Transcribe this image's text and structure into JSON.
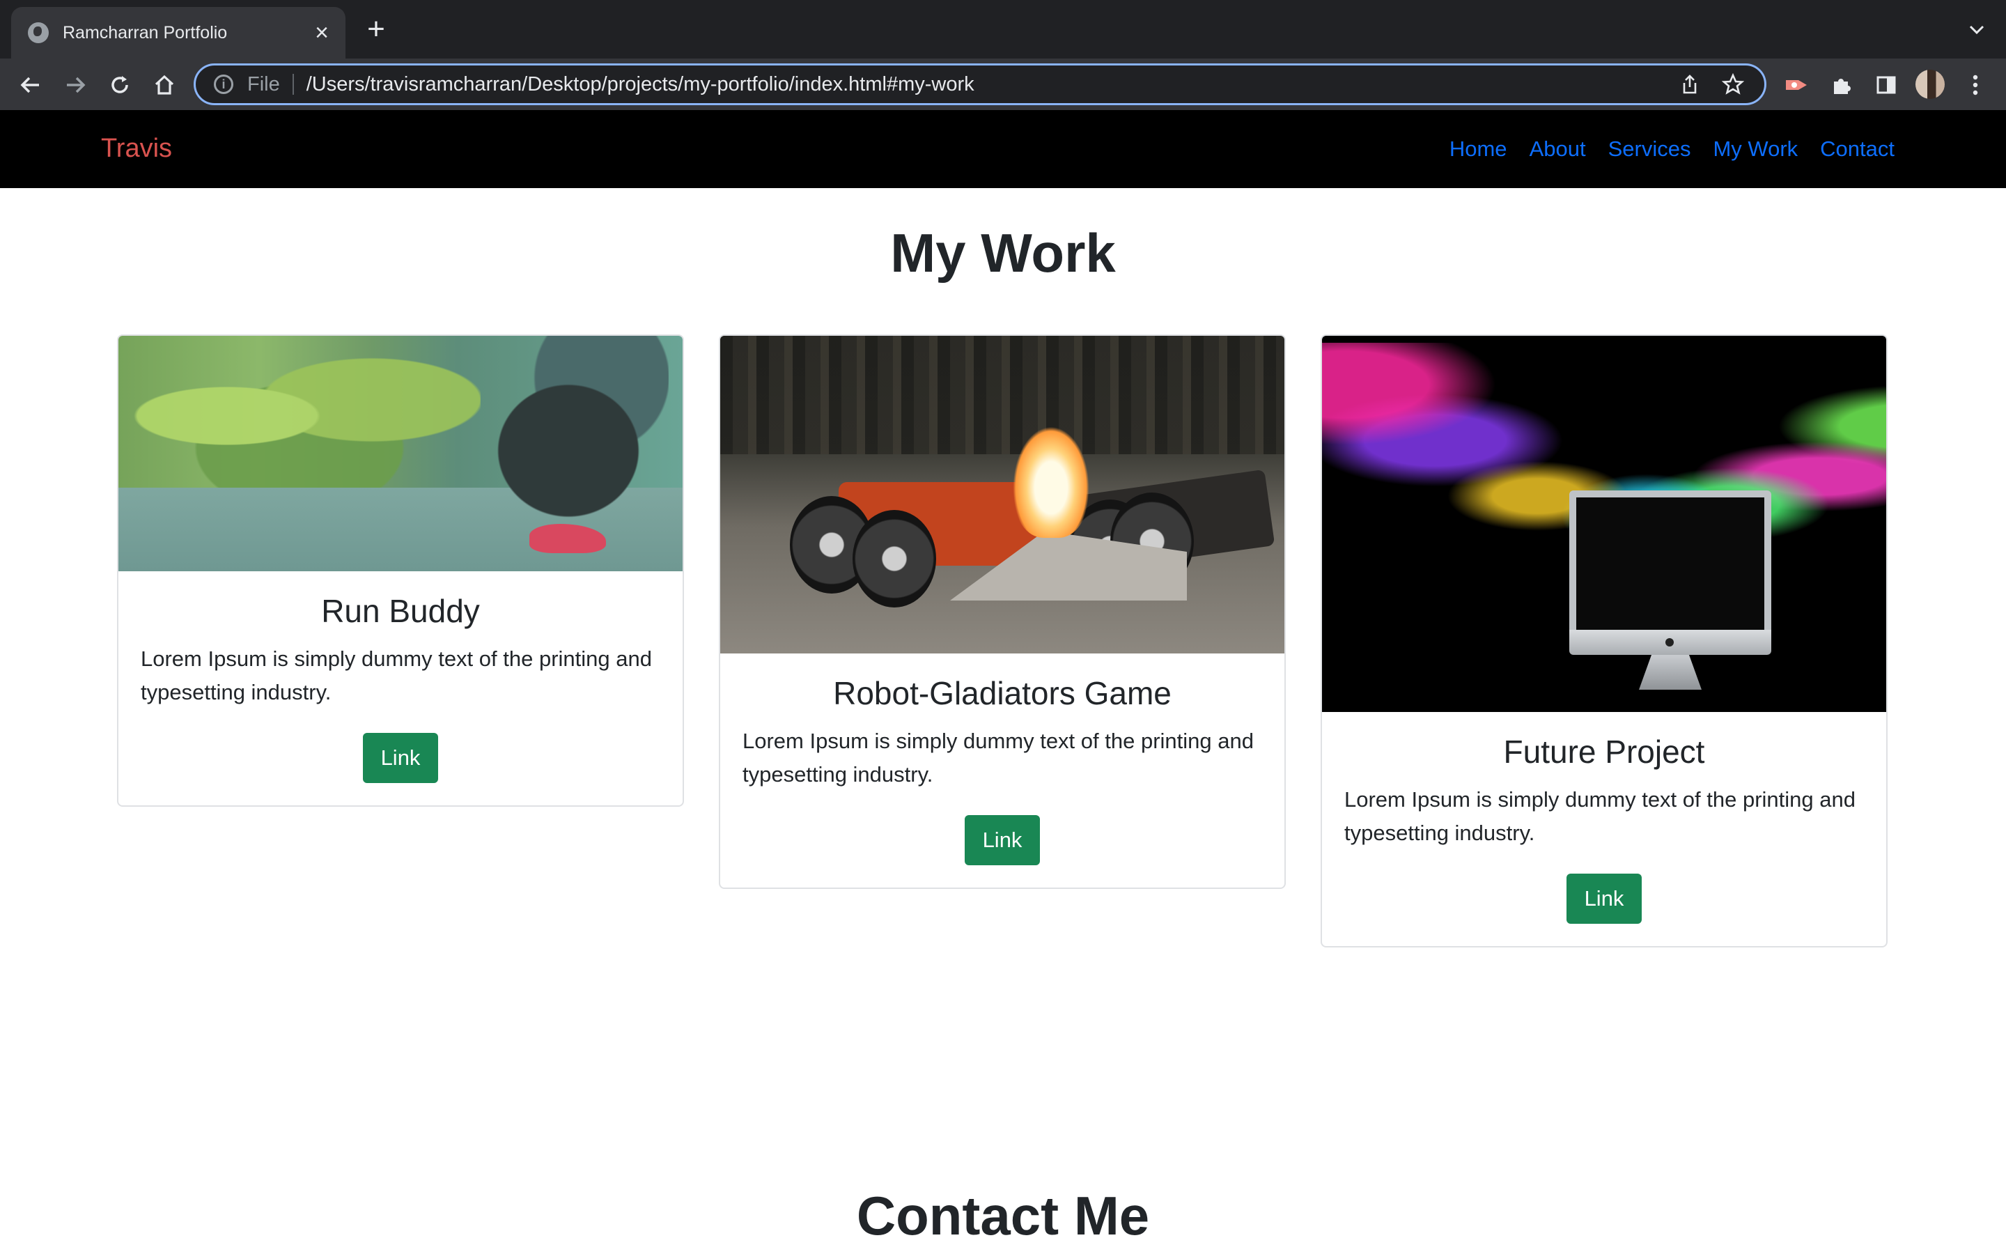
{
  "browser": {
    "tab_title": "Ramcharran Portfolio",
    "tab_close": "×",
    "new_tab": "+",
    "address_scheme": "File",
    "address_url": "/Users/travisramcharran/Desktop/projects/my-portfolio/index.html#my-work",
    "icons": [
      "globe-icon",
      "chevron-down-icon",
      "back-arrow-icon",
      "forward-arrow-icon",
      "reload-icon",
      "home-icon",
      "info-icon",
      "share-icon",
      "star-icon",
      "extension-icon",
      "puzzle-icon",
      "side-panel-icon",
      "profile-avatar",
      "more-menu-icon"
    ]
  },
  "site": {
    "brand": "Travis",
    "brand_color": "#d9534f",
    "link_color": "#0d6efd",
    "nav": [
      "Home",
      "About",
      "Services",
      "My Work",
      "Contact"
    ]
  },
  "my_work": {
    "title": "My Work",
    "button_color": "#198754",
    "cards": [
      {
        "title": "Run Buddy",
        "text": "Lorem Ipsum is simply dummy text of the printing and typesetting industry.",
        "button": "Link"
      },
      {
        "title": "Robot-Gladiators Game",
        "text": "Lorem Ipsum is simply dummy text of the printing and typesetting industry.",
        "button": "Link"
      },
      {
        "title": "Future Project",
        "text": "Lorem Ipsum is simply dummy text of the printing and typesetting industry.",
        "button": "Link"
      }
    ]
  },
  "contact": {
    "title": "Contact Me"
  }
}
